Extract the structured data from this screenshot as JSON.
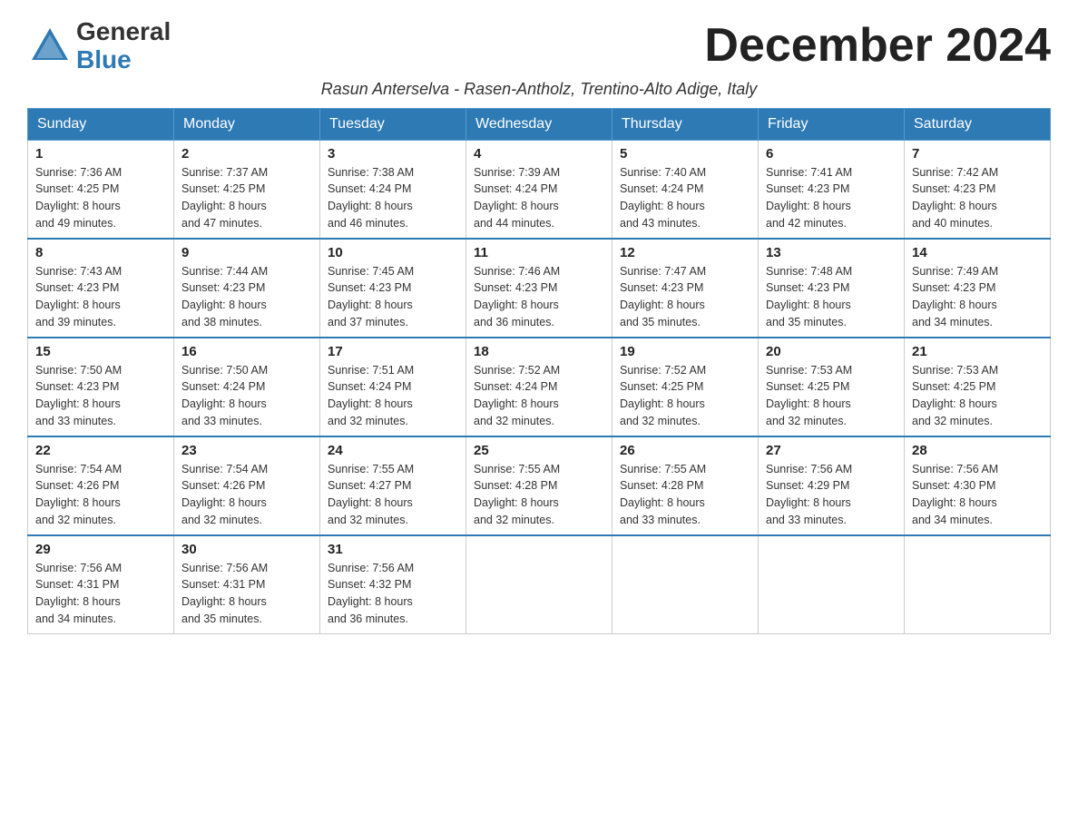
{
  "logo": {
    "general": "General",
    "blue": "Blue",
    "tagline": ""
  },
  "header": {
    "month_title": "December 2024",
    "subtitle": "Rasun Anterselva - Rasen-Antholz, Trentino-Alto Adige, Italy"
  },
  "days_of_week": [
    "Sunday",
    "Monday",
    "Tuesday",
    "Wednesday",
    "Thursday",
    "Friday",
    "Saturday"
  ],
  "weeks": [
    [
      {
        "day": "1",
        "sunrise": "7:36 AM",
        "sunset": "4:25 PM",
        "daylight": "8 hours and 49 minutes."
      },
      {
        "day": "2",
        "sunrise": "7:37 AM",
        "sunset": "4:25 PM",
        "daylight": "8 hours and 47 minutes."
      },
      {
        "day": "3",
        "sunrise": "7:38 AM",
        "sunset": "4:24 PM",
        "daylight": "8 hours and 46 minutes."
      },
      {
        "day": "4",
        "sunrise": "7:39 AM",
        "sunset": "4:24 PM",
        "daylight": "8 hours and 44 minutes."
      },
      {
        "day": "5",
        "sunrise": "7:40 AM",
        "sunset": "4:24 PM",
        "daylight": "8 hours and 43 minutes."
      },
      {
        "day": "6",
        "sunrise": "7:41 AM",
        "sunset": "4:23 PM",
        "daylight": "8 hours and 42 minutes."
      },
      {
        "day": "7",
        "sunrise": "7:42 AM",
        "sunset": "4:23 PM",
        "daylight": "8 hours and 40 minutes."
      }
    ],
    [
      {
        "day": "8",
        "sunrise": "7:43 AM",
        "sunset": "4:23 PM",
        "daylight": "8 hours and 39 minutes."
      },
      {
        "day": "9",
        "sunrise": "7:44 AM",
        "sunset": "4:23 PM",
        "daylight": "8 hours and 38 minutes."
      },
      {
        "day": "10",
        "sunrise": "7:45 AM",
        "sunset": "4:23 PM",
        "daylight": "8 hours and 37 minutes."
      },
      {
        "day": "11",
        "sunrise": "7:46 AM",
        "sunset": "4:23 PM",
        "daylight": "8 hours and 36 minutes."
      },
      {
        "day": "12",
        "sunrise": "7:47 AM",
        "sunset": "4:23 PM",
        "daylight": "8 hours and 35 minutes."
      },
      {
        "day": "13",
        "sunrise": "7:48 AM",
        "sunset": "4:23 PM",
        "daylight": "8 hours and 35 minutes."
      },
      {
        "day": "14",
        "sunrise": "7:49 AM",
        "sunset": "4:23 PM",
        "daylight": "8 hours and 34 minutes."
      }
    ],
    [
      {
        "day": "15",
        "sunrise": "7:50 AM",
        "sunset": "4:23 PM",
        "daylight": "8 hours and 33 minutes."
      },
      {
        "day": "16",
        "sunrise": "7:50 AM",
        "sunset": "4:24 PM",
        "daylight": "8 hours and 33 minutes."
      },
      {
        "day": "17",
        "sunrise": "7:51 AM",
        "sunset": "4:24 PM",
        "daylight": "8 hours and 32 minutes."
      },
      {
        "day": "18",
        "sunrise": "7:52 AM",
        "sunset": "4:24 PM",
        "daylight": "8 hours and 32 minutes."
      },
      {
        "day": "19",
        "sunrise": "7:52 AM",
        "sunset": "4:25 PM",
        "daylight": "8 hours and 32 minutes."
      },
      {
        "day": "20",
        "sunrise": "7:53 AM",
        "sunset": "4:25 PM",
        "daylight": "8 hours and 32 minutes."
      },
      {
        "day": "21",
        "sunrise": "7:53 AM",
        "sunset": "4:25 PM",
        "daylight": "8 hours and 32 minutes."
      }
    ],
    [
      {
        "day": "22",
        "sunrise": "7:54 AM",
        "sunset": "4:26 PM",
        "daylight": "8 hours and 32 minutes."
      },
      {
        "day": "23",
        "sunrise": "7:54 AM",
        "sunset": "4:26 PM",
        "daylight": "8 hours and 32 minutes."
      },
      {
        "day": "24",
        "sunrise": "7:55 AM",
        "sunset": "4:27 PM",
        "daylight": "8 hours and 32 minutes."
      },
      {
        "day": "25",
        "sunrise": "7:55 AM",
        "sunset": "4:28 PM",
        "daylight": "8 hours and 32 minutes."
      },
      {
        "day": "26",
        "sunrise": "7:55 AM",
        "sunset": "4:28 PM",
        "daylight": "8 hours and 33 minutes."
      },
      {
        "day": "27",
        "sunrise": "7:56 AM",
        "sunset": "4:29 PM",
        "daylight": "8 hours and 33 minutes."
      },
      {
        "day": "28",
        "sunrise": "7:56 AM",
        "sunset": "4:30 PM",
        "daylight": "8 hours and 34 minutes."
      }
    ],
    [
      {
        "day": "29",
        "sunrise": "7:56 AM",
        "sunset": "4:31 PM",
        "daylight": "8 hours and 34 minutes."
      },
      {
        "day": "30",
        "sunrise": "7:56 AM",
        "sunset": "4:31 PM",
        "daylight": "8 hours and 35 minutes."
      },
      {
        "day": "31",
        "sunrise": "7:56 AM",
        "sunset": "4:32 PM",
        "daylight": "8 hours and 36 minutes."
      },
      null,
      null,
      null,
      null
    ]
  ],
  "labels": {
    "sunrise": "Sunrise:",
    "sunset": "Sunset:",
    "daylight": "Daylight:"
  }
}
